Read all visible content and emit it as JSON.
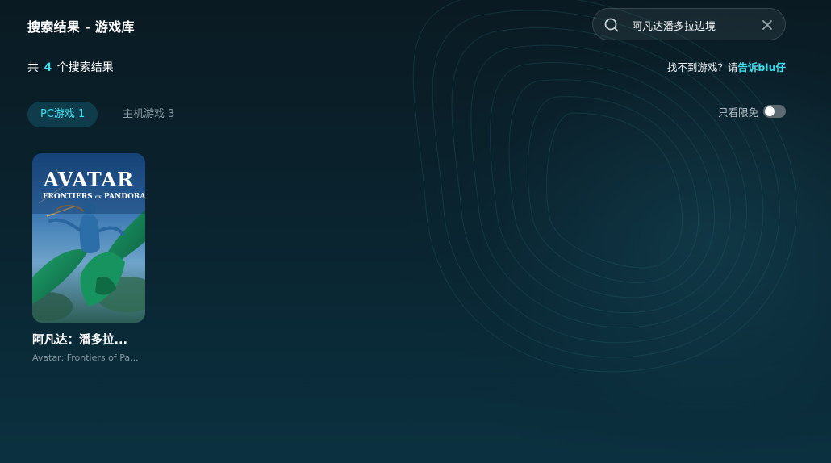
{
  "header": {
    "title": "搜索结果 - 游戏库"
  },
  "search": {
    "value": "阿凡达潘多拉边境"
  },
  "summary": {
    "prefix": "共",
    "count": "4",
    "suffix": "个搜索结果"
  },
  "help": {
    "text": "找不到游戏？请",
    "link": "告诉biu仔"
  },
  "tabs": [
    {
      "label": "PC游戏 1",
      "active": true
    },
    {
      "label": "主机游戏 3",
      "active": false
    }
  ],
  "filter": {
    "label": "只看限免",
    "enabled": false
  },
  "games": [
    {
      "name": "阿凡达：潘多拉...",
      "subtitle": "Avatar: Frontiers of Pa...",
      "cover_title": "AVATAR",
      "cover_subtitle_left": "FRONTIERS",
      "cover_subtitle_of": "OF",
      "cover_subtitle_right": "PANDORA"
    }
  ],
  "colors": {
    "accent": "#3ee0ef",
    "background": "#0a2531",
    "tab_active_bg": "#0f3c4b"
  },
  "icons": {
    "search": "search-icon",
    "clear": "close-icon"
  }
}
